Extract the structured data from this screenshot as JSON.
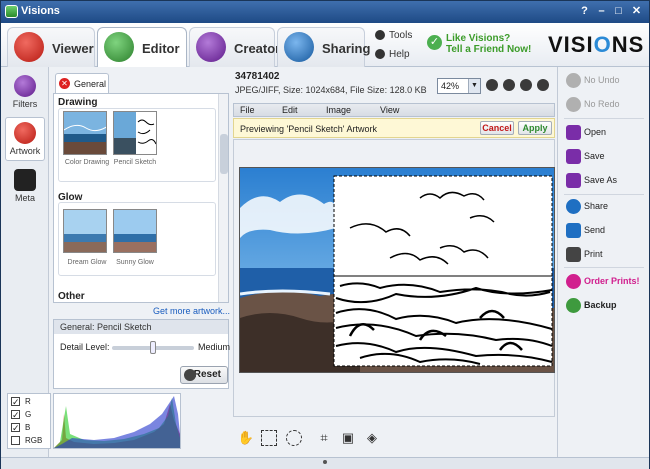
{
  "app": {
    "title": "Visions"
  },
  "window_buttons": [
    "?",
    "–",
    "□",
    "✕"
  ],
  "tabs": [
    {
      "label": "Viewer",
      "icon": "film-strip-icon",
      "color": "#d0281f"
    },
    {
      "label": "Editor",
      "icon": "brush-icon",
      "color": "#3e9a3e",
      "active": true
    },
    {
      "label": "Creator",
      "icon": "document-icon",
      "color": "#7a2da8"
    },
    {
      "label": "Sharing",
      "icon": "share-icon",
      "color": "#1f6fc2"
    }
  ],
  "top_links": {
    "tools": "Tools",
    "help": "Help"
  },
  "promo": {
    "line1": "Like Visions?",
    "line2": "Tell a Friend Now!"
  },
  "logo": {
    "text": "VISI",
    "o": "O",
    "rest": "NS"
  },
  "left_nav": [
    {
      "label": "Filters",
      "icon": "filters-icon",
      "color": "#7a2da8"
    },
    {
      "label": "Artwork",
      "icon": "artwork-icon",
      "color": "#d0281f",
      "active": true
    },
    {
      "label": "Meta",
      "icon": "meta-icon",
      "color": "#222222"
    }
  ],
  "panel": {
    "tab_label": "General",
    "sections": [
      {
        "title": "Drawing",
        "items": [
          "Color Drawing",
          "Pencil Sketch"
        ]
      },
      {
        "title": "Glow",
        "items": [
          "Dream Glow",
          "Sunny Glow"
        ]
      },
      {
        "title": "Other",
        "items": []
      }
    ],
    "get_more": "Get more artwork...",
    "settings_header": "General: Pencil Sketch",
    "detail_label": "Detail Level:",
    "detail_value": "Medium",
    "detail_level": 0.5,
    "reset_label": "Reset"
  },
  "histogram": {
    "channels": [
      {
        "label": "R",
        "checked": true
      },
      {
        "label": "G",
        "checked": true
      },
      {
        "label": "B",
        "checked": true
      },
      {
        "label": "RGB",
        "checked": false
      }
    ]
  },
  "file": {
    "name": "34781402",
    "info": "JPEG/JIFF, Size: 1024x684, File Size: 128.0 KB"
  },
  "zoom": {
    "value": "42%"
  },
  "menu": [
    "File",
    "Edit",
    "Image",
    "View"
  ],
  "preview_bar": {
    "text": "Previewing 'Pencil Sketch' Artwork",
    "cancel": "Cancel",
    "apply": "Apply"
  },
  "right_actions": [
    {
      "label": "No Undo",
      "icon": "undo-icon",
      "color": "#b0b0b0",
      "disabled": true
    },
    {
      "label": "No Redo",
      "icon": "redo-icon",
      "color": "#b0b0b0",
      "disabled": true
    },
    {
      "label": "Open",
      "icon": "open-icon",
      "color": "#7a2da8"
    },
    {
      "label": "Save",
      "icon": "save-icon",
      "color": "#7a2da8"
    },
    {
      "label": "Save As",
      "icon": "save-as-icon",
      "color": "#7a2da8"
    },
    {
      "label": "Share",
      "icon": "share-icon",
      "color": "#1f6fc2"
    },
    {
      "label": "Send",
      "icon": "send-icon",
      "color": "#1f6fc2"
    },
    {
      "label": "Print",
      "icon": "print-icon",
      "color": "#444444"
    },
    {
      "label": "Order Prints!",
      "icon": "order-prints-icon",
      "color": "#d1208e",
      "highlight": true
    },
    {
      "label": "Backup",
      "icon": "backup-icon",
      "color": "#3e9a3e",
      "bold": true
    }
  ]
}
